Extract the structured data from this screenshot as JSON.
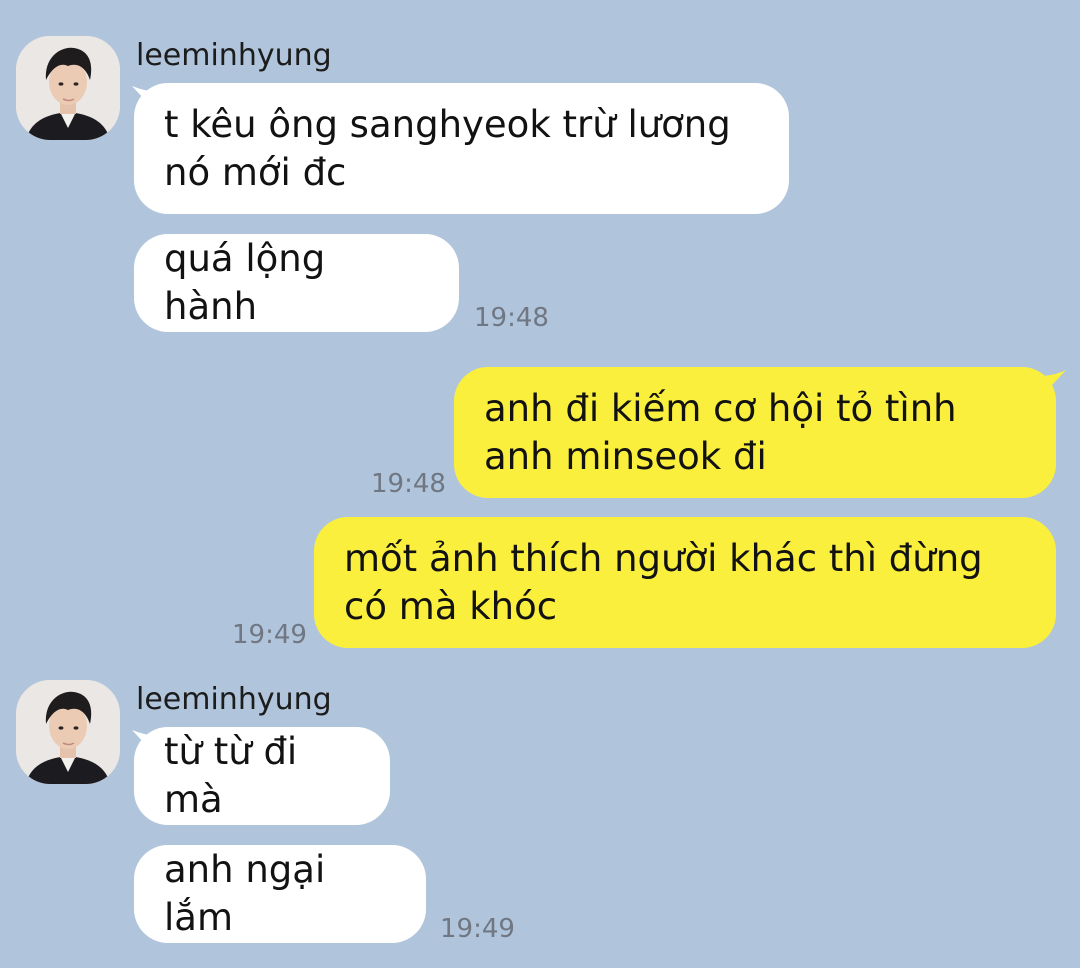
{
  "colors": {
    "background": "#b0c5db",
    "incoming_bubble": "#ffffff",
    "outgoing_bubble": "#fbef3d",
    "timestamp": "#707783"
  },
  "messages": [
    {
      "sender": "leeminhyung",
      "direction": "incoming",
      "bubbles": [
        {
          "text": "t kêu ông sanghyeok trừ lương nó mới đc"
        },
        {
          "text": "quá lộng hành"
        }
      ],
      "time": "19:48"
    },
    {
      "direction": "outgoing",
      "bubbles": [
        {
          "text": "anh đi kiếm cơ hội tỏ tình anh minseok đi",
          "time": "19:48"
        },
        {
          "text": "mốt ảnh thích người khác thì đừng có mà khóc",
          "time": "19:49"
        }
      ]
    },
    {
      "sender": "leeminhyung",
      "direction": "incoming",
      "bubbles": [
        {
          "text": "từ từ đi mà"
        },
        {
          "text": "anh ngại lắm"
        }
      ],
      "time": "19:49"
    }
  ]
}
